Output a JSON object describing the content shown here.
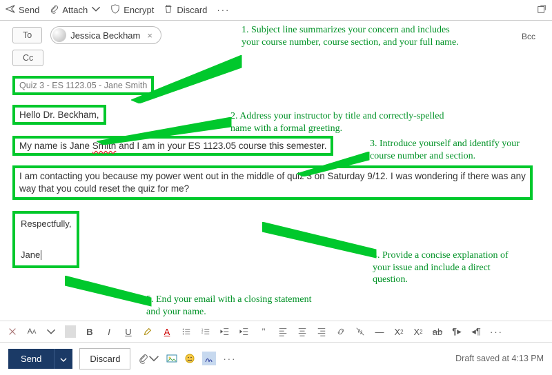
{
  "toolbar": {
    "send": "Send",
    "attach": "Attach",
    "encrypt": "Encrypt",
    "discard": "Discard"
  },
  "fields": {
    "to_label": "To",
    "cc_label": "Cc",
    "bcc_label": "Bcc",
    "recipient_name": "Jessica Beckham",
    "recipient_remove": "×",
    "subject": "Quiz 3 - ES 1123.05 - Jane Smith"
  },
  "body": {
    "greeting": "Hello Dr. Beckham,",
    "intro_pre": "My name is Jane ",
    "intro_mis": "Smith",
    "intro_post": " and I am in your ES 1123.05 course this semester.",
    "reason": "I am contacting you because my power went out in the middle of quiz 3 on Saturday 9/12. I was wondering if there was any way that you could reset the quiz for me?",
    "close1": "Respectfully,",
    "close2": "Jane"
  },
  "annotations": {
    "a1": "1. Subject line summarizes your concern and includes your course number, course section, and your full name.",
    "a2": "2. Address your instructor by title and correctly-spelled name with a formal greeting.",
    "a3": "3. Introduce yourself and identify your course number and section.",
    "a4": "4. Provide a concise explanation of your issue and include a direct question.",
    "a5": "5. End your email with a closing statement and your name."
  },
  "bottom": {
    "send": "Send",
    "discard": "Discard",
    "draft_status": "Draft saved at 4:13 PM"
  },
  "format_labels": {
    "bold": "B",
    "italic": "I",
    "underline": "U"
  }
}
